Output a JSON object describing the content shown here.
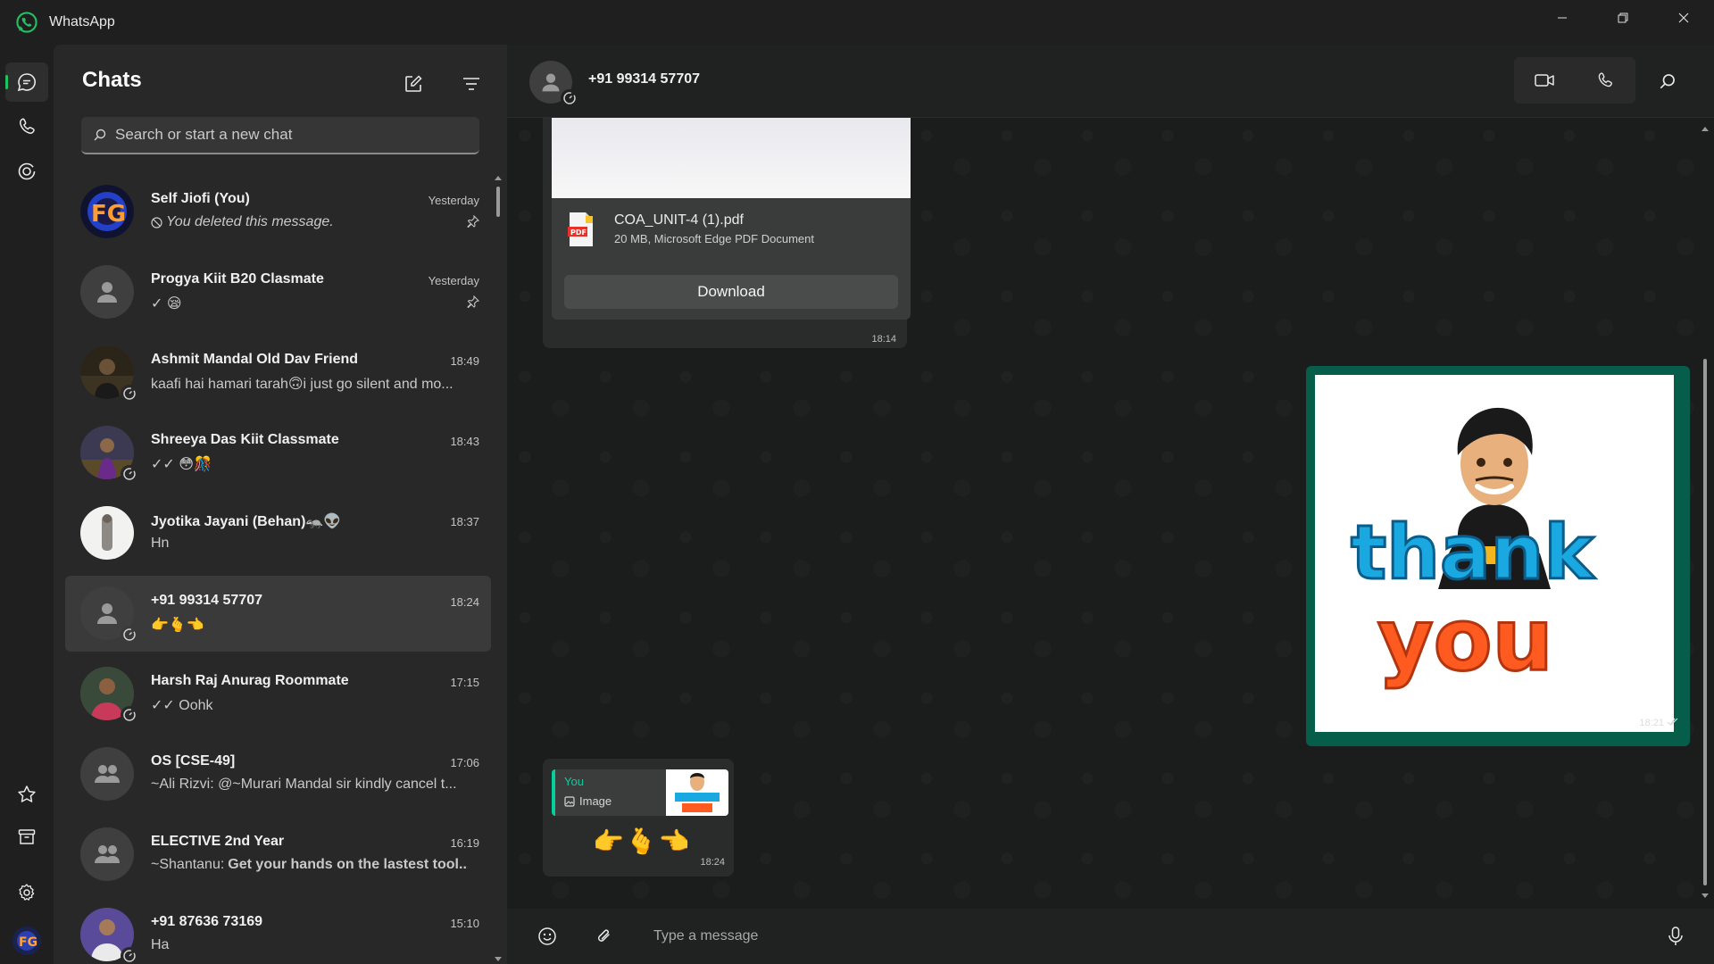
{
  "window": {
    "title": "WhatsApp",
    "colors": {
      "accent": "#21c063",
      "bg": "#1f1f1f",
      "panel": "#282828",
      "selected": "#3a3a3a",
      "outgoing": "#065e4a"
    }
  },
  "rail": {
    "items": [
      "chats-icon",
      "calls-icon",
      "status-icon",
      "starred-icon",
      "archive-icon",
      "settings-icon"
    ]
  },
  "chatlist": {
    "title": "Chats",
    "search_placeholder": "Search or start a new chat",
    "items": [
      {
        "name": "Self Jiofi (You)",
        "time": "Yesterday",
        "preview": "You deleted this message.",
        "pinned": true
      },
      {
        "name": "Progya Kiit B20 Clasmate",
        "time": "Yesterday",
        "preview": "✓ 😪",
        "pinned": true
      },
      {
        "name": "Ashmit Mandal Old Dav Friend",
        "time": "18:49",
        "preview": "kaafi hai hamari tarah🙃i just go silent and mo..."
      },
      {
        "name": "Shreeya Das Kiit Classmate",
        "time": "18:43",
        "preview": "✓✓ 😳🎊"
      },
      {
        "name": "Jyotika Jayani (Behan)🦡👽",
        "time": "18:37",
        "preview": "Hn"
      },
      {
        "name": "+91 99314 57707",
        "time": "18:24",
        "preview": "👉🫰👈",
        "selected": true
      },
      {
        "name": "Harsh Raj Anurag Roommate",
        "time": "17:15",
        "preview": "✓✓ Oohk"
      },
      {
        "name": "OS [CSE-49]",
        "time": "17:06",
        "preview": "~Ali Rizvi: @~Murari Mandal sir kindly cancel t..."
      },
      {
        "name": "ELECTIVE 2nd Year",
        "time": "16:19",
        "preview_sender": "~Shantanu:",
        "preview": "Get your hands on the lastest tool..."
      },
      {
        "name": "+91 87636 73169",
        "time": "15:10",
        "preview": "Ha"
      }
    ]
  },
  "conversation": {
    "contact": "+91 99314 57707",
    "compose_placeholder": "Type a message",
    "messages": {
      "document": {
        "filename": "COA_UNIT-4 (1).pdf",
        "meta": "20 MB, Microsoft Edge PDF Document",
        "action": "Download",
        "time": "18:14",
        "icon_label": "PDF"
      },
      "sticker": {
        "text_line1": "thank",
        "text_line2": "you",
        "time": "18:21"
      },
      "reply": {
        "quote_author": "You",
        "quote_type": "Image",
        "body": "👉🫰👈",
        "time": "18:24"
      }
    }
  }
}
